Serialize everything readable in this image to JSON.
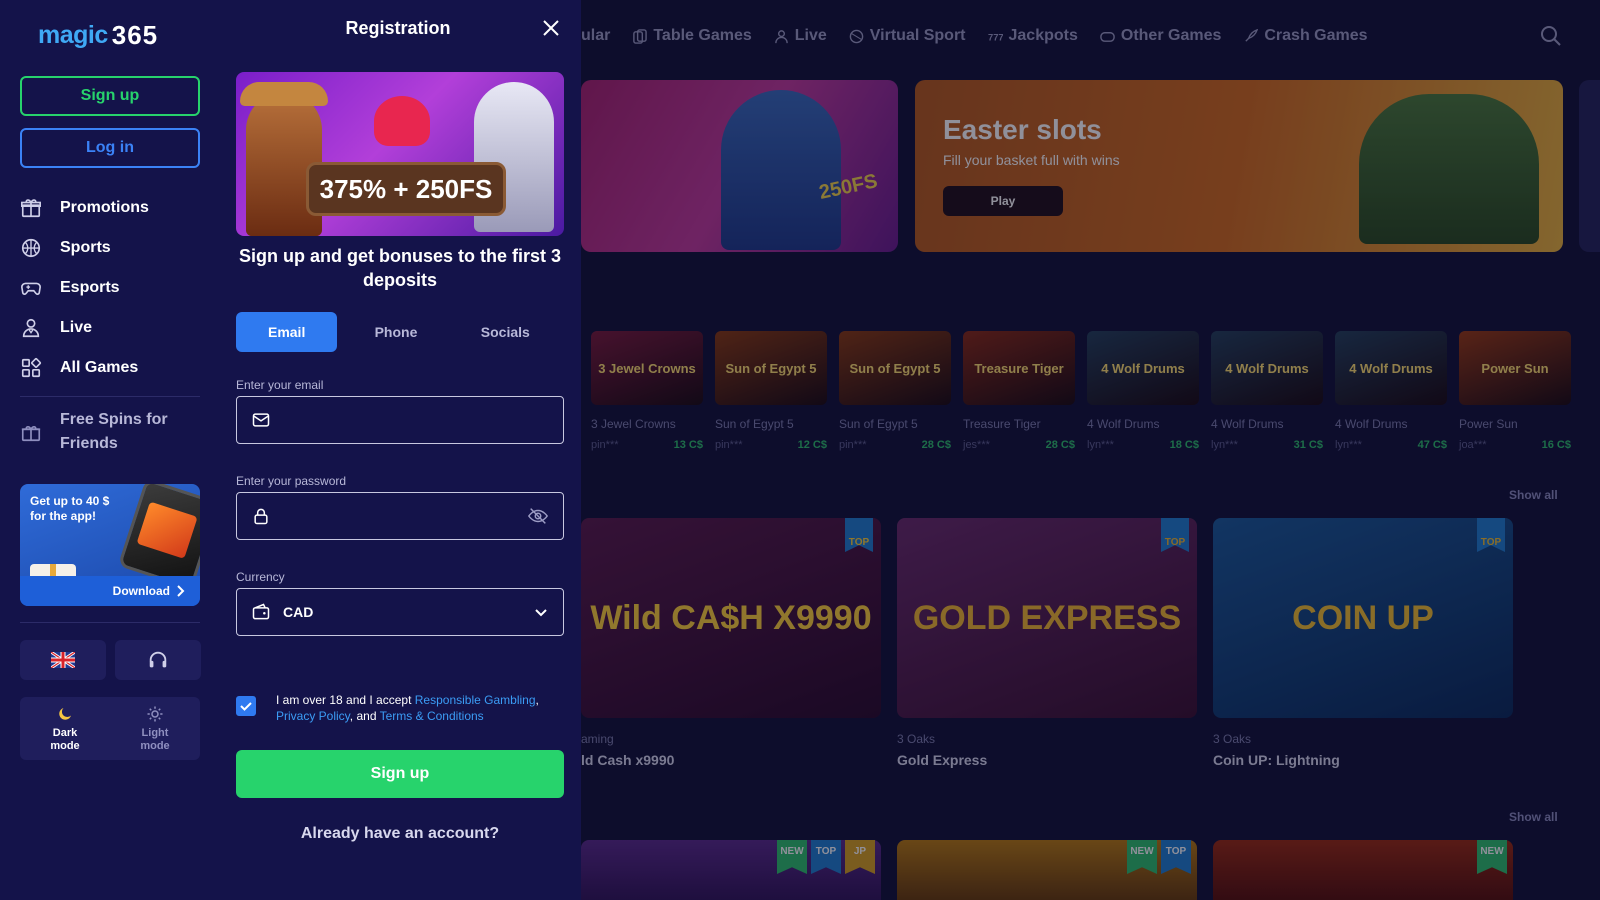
{
  "sidebar": {
    "logo": {
      "word": "magic",
      "number": "365"
    },
    "signup_label": "Sign up",
    "login_label": "Log in",
    "nav": [
      {
        "label": "Promotions",
        "icon": "gift-icon"
      },
      {
        "label": "Sports",
        "icon": "basketball-icon"
      },
      {
        "label": "Esports",
        "icon": "gamepad-icon"
      },
      {
        "label": "Live",
        "icon": "dealer-icon"
      },
      {
        "label": "All Games",
        "icon": "grid-icon"
      }
    ],
    "free_spins_label": "Free Spins for Friends",
    "promo": {
      "text": "Get up to 40 $ for the app!",
      "download_label": "Download"
    },
    "language": "flag-uk-icon",
    "modes": [
      {
        "label": "Dark mode",
        "active": true
      },
      {
        "label": "Light mode",
        "active": false
      }
    ]
  },
  "modal": {
    "title": "Registration",
    "banner_text": "375% + 250FS",
    "subtitle": "Sign up and get bonuses to the first 3 deposits",
    "tabs": [
      {
        "label": "Email",
        "active": true
      },
      {
        "label": "Phone",
        "active": false
      },
      {
        "label": "Socials",
        "active": false
      }
    ],
    "email_label": "Enter your email",
    "email_value": "",
    "password_label": "Enter your password",
    "password_value": "",
    "currency_label": "Currency",
    "currency_value": "CAD",
    "consent": {
      "prefix": "I am over 18 and I accept",
      "link1": "Responsible Gambling",
      "sep": ",",
      "link2": "Privacy Policy",
      "and": ", and",
      "link3": "Terms & Conditions",
      "checked": true
    },
    "signup_label": "Sign up",
    "already_label": "Already have an account?"
  },
  "background": {
    "top_nav": [
      {
        "label": "ular"
      },
      {
        "label": "Table Games"
      },
      {
        "label": "Live"
      },
      {
        "label": "Virtual Sport"
      },
      {
        "label": "Jackpots"
      },
      {
        "label": "Other Games"
      },
      {
        "label": "Crash Games"
      }
    ],
    "hero1_text": "250FS",
    "hero2": {
      "title": "Easter slots",
      "subtitle": "Fill your basket full with wins",
      "play_label": "Play"
    },
    "recent_wins": [
      {
        "name": "3 Jewel Crowns",
        "user": "pin***",
        "amount": "13 C$",
        "color": "#7a1a3a"
      },
      {
        "name": "Sun of Egypt 5",
        "user": "pin***",
        "amount": "12 C$",
        "color": "#8a3a10"
      },
      {
        "name": "Sun of Egypt 5",
        "user": "pin***",
        "amount": "28 C$",
        "color": "#8a3a10"
      },
      {
        "name": "Treasure Tiger",
        "user": "jes***",
        "amount": "28 C$",
        "color": "#8a2a14"
      },
      {
        "name": "4 Wolf Drums",
        "user": "lyn***",
        "amount": "18 C$",
        "color": "#24405a"
      },
      {
        "name": "4 Wolf Drums",
        "user": "lyn***",
        "amount": "31 C$",
        "color": "#24405a"
      },
      {
        "name": "4 Wolf Drums",
        "user": "lyn***",
        "amount": "47 C$",
        "color": "#24405a"
      },
      {
        "name": "Power Sun",
        "user": "joa***",
        "amount": "16 C$",
        "color": "#9a3a12"
      }
    ],
    "show_all_label": "Show all",
    "big_games": [
      {
        "provider": "aming",
        "name": "ld Cash x9990",
        "art": "Wild CA$H X9990",
        "badge": "TOP",
        "color": "#5a1a4a"
      },
      {
        "provider": "3 Oaks",
        "name": "Gold Express",
        "art": "GOLD EXPRESS",
        "badge": "TOP",
        "color": "#5a2a5a"
      },
      {
        "provider": "3 Oaks",
        "name": "Coin UP: Lightning",
        "art": "COIN UP",
        "badge": "TOP",
        "color": "#1a4a7a"
      }
    ],
    "bottom_tags": [
      [
        "NEW",
        "TOP",
        "JP"
      ],
      [
        "NEW",
        "TOP"
      ],
      [
        "NEW"
      ]
    ]
  }
}
